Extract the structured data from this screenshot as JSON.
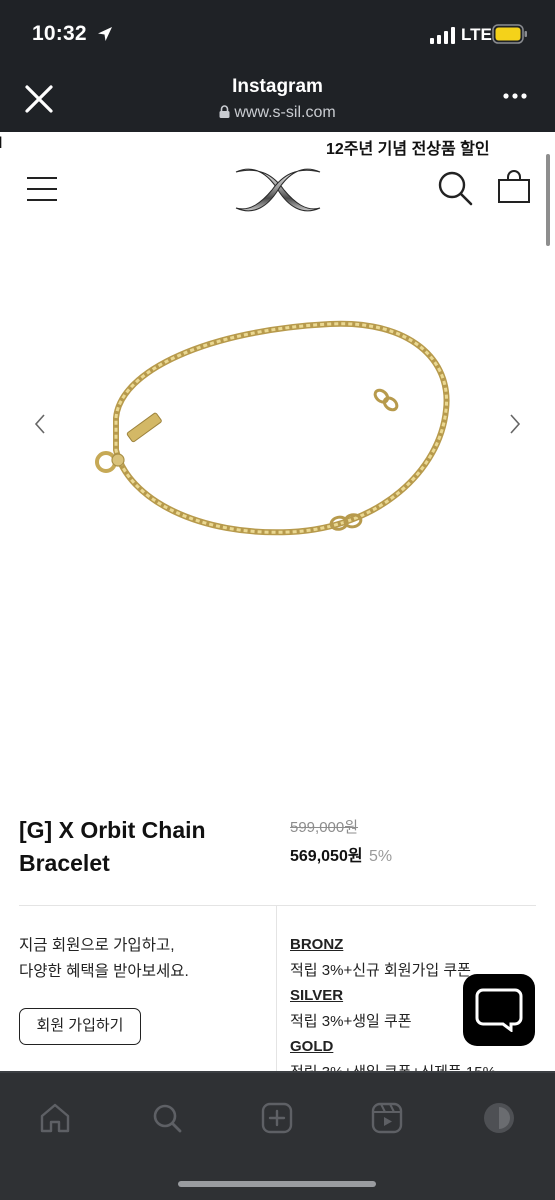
{
  "status_bar": {
    "time": "10:32",
    "network": "LTE",
    "battery_color": "#f4d21a"
  },
  "browser": {
    "title": "Instagram",
    "url": "www.s-sil.com",
    "close_icon": "close-icon",
    "more_icon": "more-dots-icon"
  },
  "site": {
    "promo_fragment": "l",
    "promo": "12주년 기념 전상품 할인",
    "menu_icon": "hamburger-icon",
    "search_icon": "search-icon",
    "cart_icon": "shopping-bag-icon"
  },
  "product": {
    "name": "[G] X Orbit Chain Bracelet",
    "original_price": "599,000원",
    "sale_price": "569,050원",
    "discount": "5%",
    "image_colors": {
      "gold": "#d9c27a",
      "gold_dark": "#a88f45"
    }
  },
  "membership": {
    "invite_line1": "지금 회원으로 가입하고,",
    "invite_line2": "다양한 혜택을 받아보세요.",
    "join_button": "회원 가입하기",
    "tiers": [
      {
        "name": "BRONZ",
        "benefit": "적립 3%+신규 회원가입 쿠폰"
      },
      {
        "name": "SILVER",
        "benefit": "적립 3%+생일 쿠폰"
      },
      {
        "name": "GOLD",
        "benefit": "적립 3%+생일 쿠폰+신제품 15%"
      }
    ]
  },
  "tabbar": {
    "tabs": [
      "home-icon",
      "search-icon",
      "create-icon",
      "reels-icon",
      "profile-icon"
    ]
  }
}
